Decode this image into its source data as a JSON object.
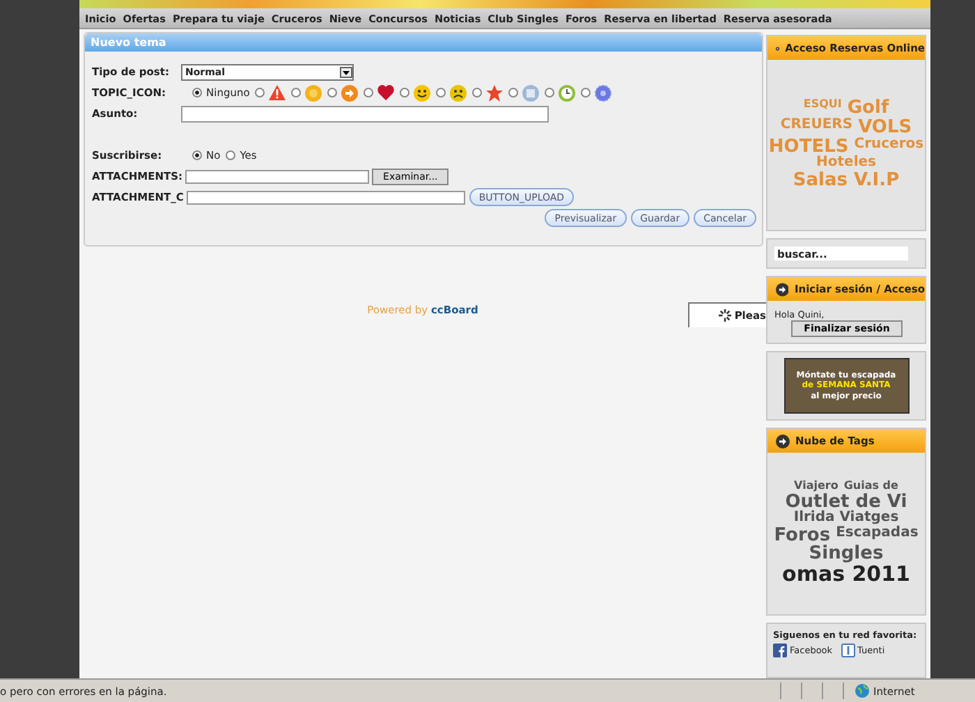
{
  "nav": [
    "Inicio",
    "Ofertas",
    "Prepara tu viaje",
    "Cruceros",
    "Nieve",
    "Concursos",
    "Noticias",
    "Club Singles",
    "Foros",
    "Reserva en libertad",
    "Reserva asesorada"
  ],
  "form": {
    "title": "Nuevo tema",
    "post_type": {
      "label": "Tipo de post:",
      "value": "Normal"
    },
    "topic_icon": {
      "label": "TOPIC_ICON:",
      "options": [
        {
          "kind": "none",
          "label": "Ninguno",
          "selected": true
        },
        {
          "kind": "warning",
          "selected": false
        },
        {
          "kind": "question",
          "selected": false
        },
        {
          "kind": "arrow",
          "selected": false
        },
        {
          "kind": "heart",
          "selected": false
        },
        {
          "kind": "smile",
          "selected": false
        },
        {
          "kind": "sad",
          "selected": false
        },
        {
          "kind": "star",
          "selected": false
        },
        {
          "kind": "picture",
          "selected": false
        },
        {
          "kind": "clock",
          "selected": false
        },
        {
          "kind": "gear",
          "selected": false
        }
      ]
    },
    "subject": {
      "label": "Asunto:"
    },
    "subscribe": {
      "label": "Suscribirse:",
      "options": [
        {
          "label": "No",
          "selected": true
        },
        {
          "label": "Yes",
          "selected": false
        }
      ]
    },
    "attachments": {
      "label": "ATTACHMENTS:",
      "button": "Examinar..."
    },
    "attachment_c": {
      "label": "ATTACHMENT_C",
      "button": "BUTTON_UPLOAD"
    },
    "actions": [
      "Previsualizar",
      "Guardar",
      "Cancelar"
    ]
  },
  "powered": {
    "prefix": "Powered by",
    "brand": "ccBoard"
  },
  "loading": "Pleas",
  "sidebar": {
    "reservas": {
      "title": "Acceso Reservas Online",
      "tags": [
        {
          "text": "ESQUI",
          "kind": "small"
        },
        {
          "text": "Golf",
          "kind": "large"
        },
        {
          "text": "CREUERS",
          "kind": "medium"
        },
        {
          "text": "VOLS",
          "kind": "large"
        },
        {
          "text": "HOTELS",
          "kind": "large"
        },
        {
          "text": "Cruceros",
          "kind": "medium"
        },
        {
          "text": "Hoteles",
          "kind": "medium"
        },
        {
          "text": "Salas V.I.P",
          "kind": "large"
        }
      ]
    },
    "search": {
      "placeholder": "buscar..."
    },
    "login": {
      "title": "Iniciar sesión / Acceso",
      "greeting": "Hola Quini,",
      "button": "Finalizar sesión"
    },
    "ad": {
      "lines": [
        "Móntate tu escapada",
        "de SEMANA SANTA",
        "al mejor precio"
      ]
    },
    "tags": {
      "title": "Nube de Tags",
      "tags": [
        {
          "text": "Viajero",
          "kind": "small"
        },
        {
          "text": "Guias de",
          "kind": "small"
        },
        {
          "text": "Outlet de Vi",
          "kind": "large"
        },
        {
          "text": "Ilrida Viatges",
          "kind": "medium"
        },
        {
          "text": "Foros",
          "kind": "large"
        },
        {
          "text": "Escapadas",
          "kind": "medium"
        },
        {
          "text": "Singles",
          "kind": "large"
        },
        {
          "text": "omas 2011",
          "kind": "huge"
        }
      ]
    },
    "social": {
      "title": "Siguenos en tu red favorita:",
      "links": [
        {
          "kind": "facebook",
          "label": "Facebook"
        },
        {
          "kind": "tuenti",
          "label": "Tuenti"
        }
      ]
    }
  },
  "status_bar": {
    "message": "o pero con errores en la página.",
    "zone": "Internet"
  }
}
